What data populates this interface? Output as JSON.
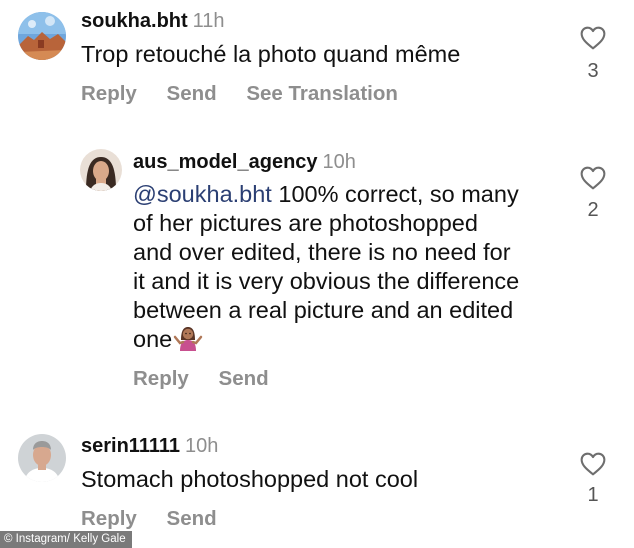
{
  "comments": [
    {
      "username": "soukha.bht",
      "time": "11h",
      "text": "Trop retouché la photo quand même",
      "likes": "3",
      "actions": [
        "Reply",
        "Send",
        "See Translation"
      ]
    },
    {
      "username": "aus_model_agency",
      "time": "10h",
      "mention": "@soukha.bht",
      "text_lines": [
        " 100% correct, so many",
        "of her pictures are photoshopped",
        "and over edited, there is no need for",
        "it and it is very obvious the difference",
        "between a real picture and an edited",
        "one"
      ],
      "emoji": "woman-shrugging-emoji",
      "likes": "2",
      "actions": [
        "Reply",
        "Send"
      ]
    },
    {
      "username": "serin11111",
      "time": "10h",
      "text": "Stomach photoshopped not cool",
      "likes": "1",
      "actions": [
        "Reply",
        "Send"
      ]
    }
  ],
  "credit": "© Instagram/ Kelly Gale",
  "icons": {
    "like": "heart-outline-icon"
  },
  "colors": {
    "muted": "#8e8e8e",
    "mention": "#2b3f73",
    "text": "#111111"
  }
}
